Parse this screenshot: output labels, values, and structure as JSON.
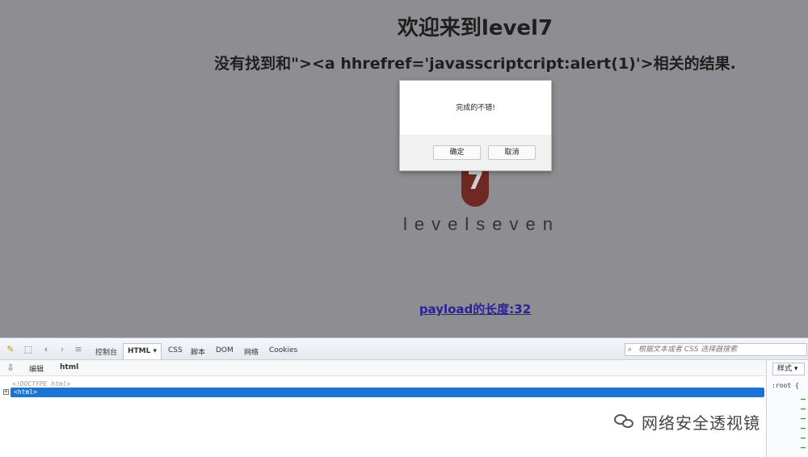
{
  "page": {
    "heading": "欢迎来到level7",
    "message": "没有找到和\"><a hhrefref='javasscriptcript:alert(1)'>相关的结果.",
    "logo_seven": "7",
    "logo_text": "levelseven",
    "payload_link": "payload的长度:32"
  },
  "dialog": {
    "message": "完成的不错!",
    "ok_label": "确定",
    "cancel_label": "取消"
  },
  "devtools": {
    "tabs": [
      "控制台",
      "HTML",
      "CSS",
      "脚本",
      "DOM",
      "网络",
      "Cookies"
    ],
    "html_dropdown": "▾",
    "search_placeholder": "根据文本或者 CSS 选择器搜索",
    "edit_label": "编辑",
    "breadcrumb": "html",
    "tree": {
      "doctype": "<!DOCTYPE html>",
      "selected_node": "<html>",
      "expander": "+"
    },
    "side_tab": "样式 ▾",
    "side_rule": ":root {"
  },
  "watermark": {
    "text": "网络安全透视镜"
  },
  "colors": {
    "overlay_bg": "#8e8e92",
    "selected_node": "#1874d5",
    "link": "#2a1fa0",
    "logo_badge": "#6e2a22"
  }
}
